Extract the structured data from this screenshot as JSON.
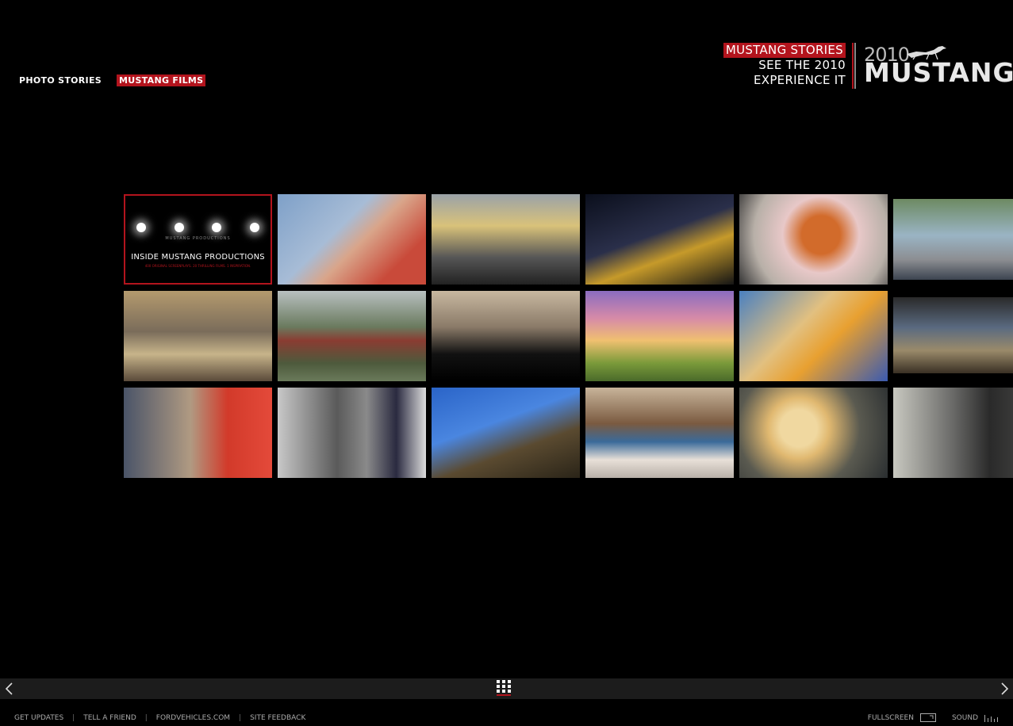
{
  "topnav": {
    "photo_stories": "PHOTO STORIES",
    "mustang_films": "MUSTANG FILMS"
  },
  "brand": {
    "menu": [
      "MUSTANG STORIES",
      "SEE THE 2010",
      "EXPERIENCE IT"
    ],
    "year": "2010",
    "wordmark": "MUSTANG"
  },
  "featured": {
    "production": "MUSTANG PRODUCTIONS",
    "title": "INSIDE MUSTANG PRODUCTIONS",
    "subtitle": "400 ORIGINAL SCREENPLAYS. 20 THRILLING FILMS. 1 INSPIRATION."
  },
  "footer": {
    "links": [
      "GET UPDATES",
      "TELL A FRIEND",
      "FORDVEHICLES.COM",
      "SITE FEEDBACK"
    ],
    "fullscreen": "FULLSCREEN",
    "sound": "SOUND"
  },
  "colors": {
    "accent": "#b3141d",
    "bar": "#1c1c1c"
  },
  "icons": [
    "prev-arrow-icon",
    "grid-icon",
    "next-arrow-icon",
    "fullscreen-icon",
    "sound-icon",
    "mustang-horse-icon"
  ]
}
